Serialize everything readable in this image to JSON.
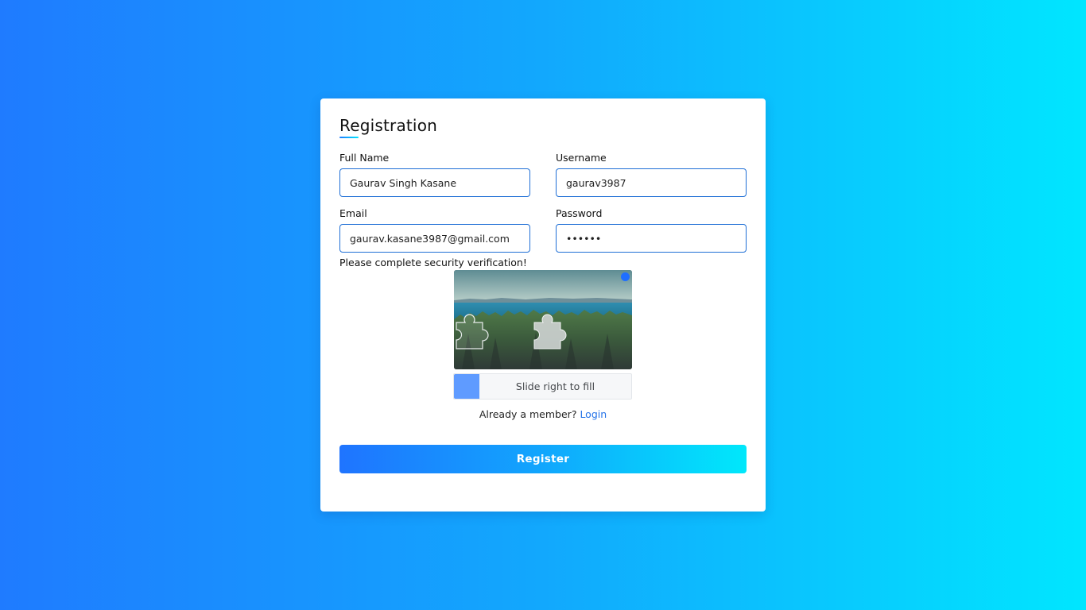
{
  "form": {
    "title": "Registration",
    "fields": {
      "full_name": {
        "label": "Full Name",
        "value": "Gaurav Singh Kasane"
      },
      "username": {
        "label": "Username",
        "value": "gaurav3987"
      },
      "email": {
        "label": "Email",
        "value": "gaurav.kasane3987@gmail.com"
      },
      "password": {
        "label": "Password",
        "value": "••••••"
      }
    },
    "security_notice": "Please complete security verification!",
    "captcha": {
      "slider_text": "Slide right to fill",
      "refresh_icon": "refresh-dot-icon",
      "slider_progress": 0
    },
    "login_prompt": {
      "text": "Already a member?",
      "link_text": "Login"
    },
    "register_label": "Register"
  },
  "colors": {
    "background_start": "#1f7bff",
    "background_end": "#00e6ff",
    "input_border": "#1f6fd6",
    "link": "#2573e8",
    "slider_handle": "#5f9bff"
  }
}
